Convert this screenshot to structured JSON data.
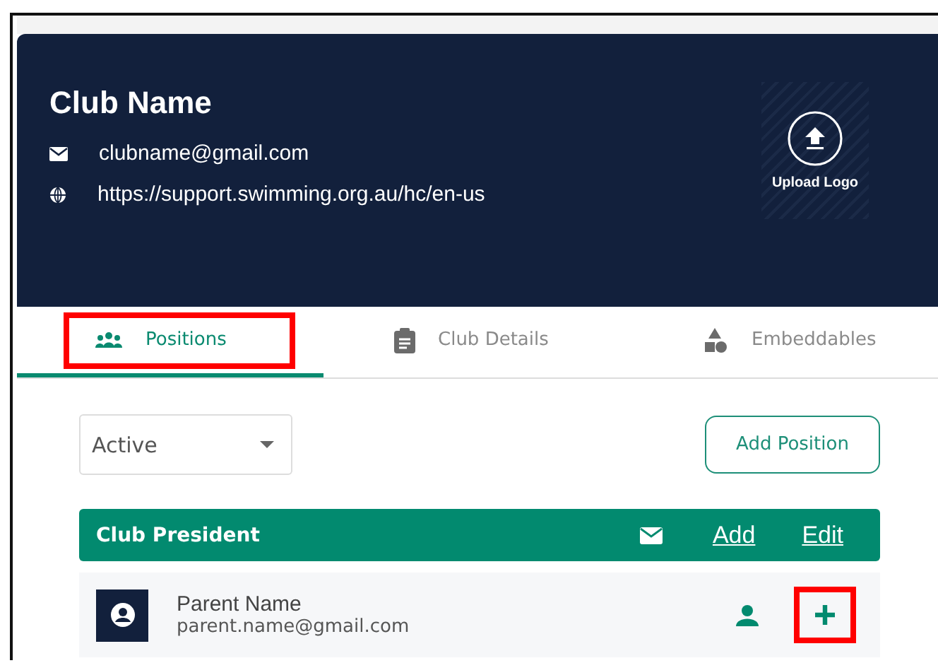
{
  "club": {
    "name": "Club Name",
    "email": "clubname@gmail.com",
    "website": "https://support.swimming.org.au/hc/en-us",
    "upload_label": "Upload Logo"
  },
  "tabs": [
    {
      "label": "Positions",
      "selected": true,
      "highlighted": true,
      "kind": "people"
    },
    {
      "label": "Club Details",
      "selected": false,
      "highlighted": false,
      "kind": "clipboard"
    },
    {
      "label": "Embeddables",
      "selected": false,
      "highlighted": false,
      "kind": "shapes"
    }
  ],
  "filter": {
    "value": "Active"
  },
  "add_position_button": "Add Position",
  "positions": [
    {
      "title": "Club President",
      "add_link": "Add",
      "edit_link": "Edit",
      "members": [
        {
          "name": "Parent Name",
          "email": "parent.name@gmail.com",
          "add_highlighted": true
        }
      ]
    }
  ]
}
